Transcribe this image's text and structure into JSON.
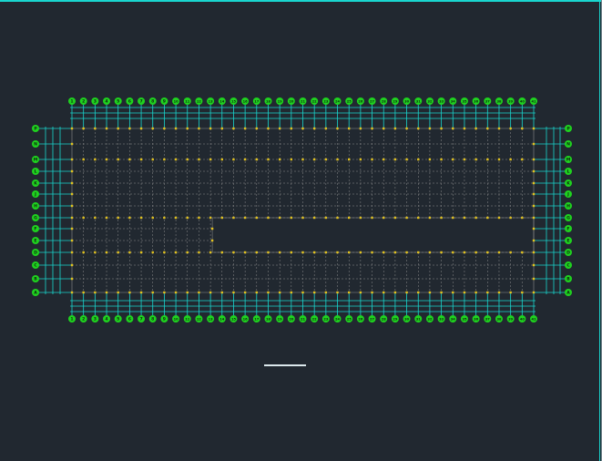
{
  "drawing": {
    "title": "",
    "column_axes": [
      "1",
      "2",
      "3",
      "4",
      "5",
      "6",
      "7",
      "8",
      "9",
      "10",
      "11",
      "12",
      "13",
      "14",
      "15",
      "16",
      "17",
      "18",
      "19",
      "20",
      "21",
      "22",
      "23",
      "24",
      "25",
      "26",
      "27",
      "28",
      "29",
      "30",
      "31",
      "32",
      "33",
      "34",
      "35",
      "36",
      "37",
      "38",
      "39",
      "40",
      "41"
    ],
    "row_axes": [
      "P",
      "N",
      "M",
      "L",
      "K",
      "J",
      "H",
      "G",
      "F",
      "E",
      "D",
      "C",
      "B",
      "A"
    ],
    "empty_zone": {
      "from_column": "13",
      "to_column": "41",
      "between_rows": [
        "G",
        "D"
      ]
    },
    "colors": {
      "background": "#212830",
      "bubble": "#1fd21f",
      "axis_line": "#19d6ce",
      "grid": "#8d8d8d",
      "column_mark": "#e2c21e"
    }
  }
}
